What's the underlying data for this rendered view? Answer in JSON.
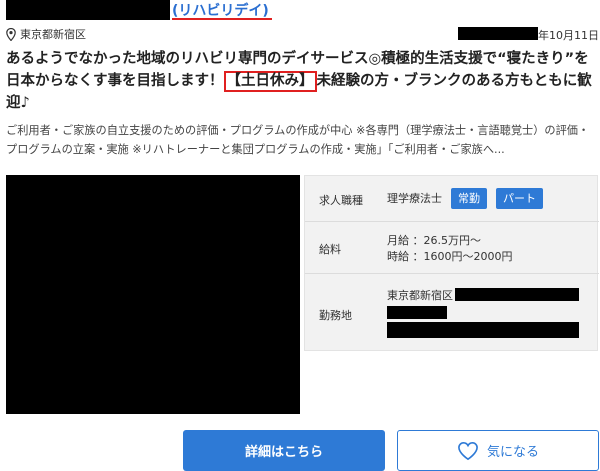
{
  "header": {
    "brand": "(リハビリデイ)",
    "location": "東京都新宿区",
    "date": "年10月11日"
  },
  "headline": {
    "part1": "あるようでなかった地域のリハビリ専門のデイサービス◎積極的生活支援で“寝たきり”を日本からなくす事を目指します！",
    "tag": "【土日休み】",
    "part2": "未経験の方・ブランクのある方もともに歓迎♪"
  },
  "description": "ご利用者・ご家族の自立支援のための評価・プログラムの作成が中心 ※各専門（理学療法士・言語聴覚士）の評価・プログラムの立案・実施 ※リハトレーナーと集団プログラムの作成・実施」「ご利用者・ご家族へ...",
  "details": {
    "job_label": "求人職種",
    "job_value": "理学療法士",
    "tag_fulltime": "常勤",
    "tag_parttime": "パート",
    "salary_label": "給料",
    "salary_monthly": "月給 ：26.5万円～",
    "salary_hourly": "時給 ：1600円～2000円",
    "work_label": "勤務地",
    "work_value": "東京都新宿区"
  },
  "buttons": {
    "detail": "詳細はこちら",
    "favorite": "気になる"
  },
  "colors": {
    "accent": "#2e7ad6",
    "highlight": "#e02020"
  },
  "icons": {
    "location": "map-pin-icon",
    "favorite": "heart-icon"
  }
}
